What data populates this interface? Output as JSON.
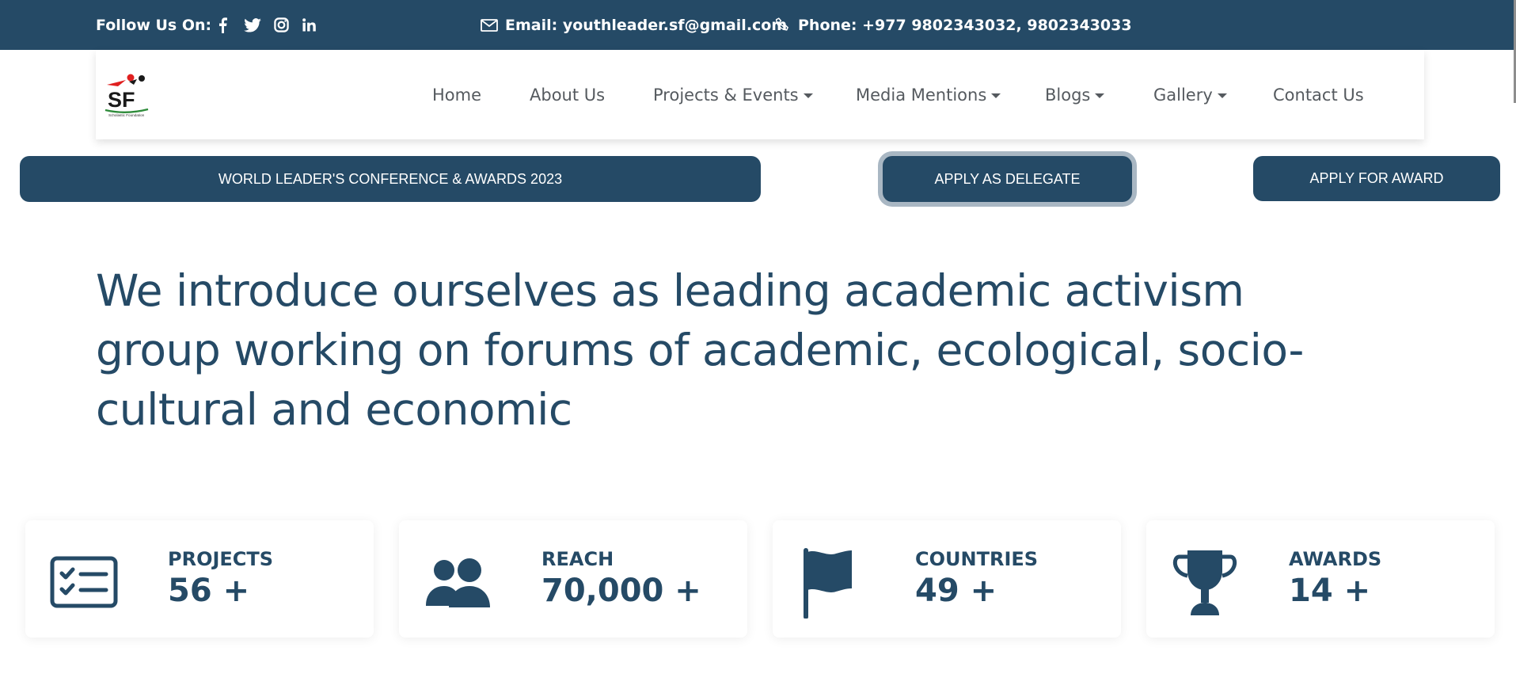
{
  "topbar": {
    "follow_label": "Follow Us On:",
    "social": [
      "facebook-icon",
      "twitter-icon",
      "instagram-icon",
      "linkedin-icon"
    ],
    "email": "Email: youthleader.sf@gmail.com",
    "phone": "Phone: +977 9802343032, 9802343033"
  },
  "logo": {
    "text": "SF",
    "caption": "Scholastic Foundation"
  },
  "nav": {
    "home": "Home",
    "about": "About Us",
    "projects": "Projects & Events",
    "media": "Media Mentions",
    "blogs": "Blogs",
    "gallery": "Gallery",
    "contact": "Contact Us"
  },
  "actions": {
    "conference": "WORLD LEADER'S CONFERENCE & AWARDS 2023",
    "delegate": "APPLY AS DELEGATE",
    "award": "APPLY FOR AWARD"
  },
  "hero": {
    "line1": "We introduce ourselves as leading academic activism",
    "line2": "group working on forums of academic, ecological, socio-",
    "line3": "cultural and economic"
  },
  "stats": [
    {
      "label": "PROJECTS",
      "value": "56 +",
      "icon": "checklist-icon"
    },
    {
      "label": "REACH",
      "value": "70,000 +",
      "icon": "users-icon"
    },
    {
      "label": "COUNTRIES",
      "value": "49 +",
      "icon": "flag-icon"
    },
    {
      "label": "AWARDS",
      "value": "14 +",
      "icon": "trophy-icon"
    }
  ],
  "colors": {
    "primary": "#254a66",
    "nav_text": "#555a5f",
    "focus_ring": "#a9b7c3",
    "logo_red": "#e02020"
  }
}
